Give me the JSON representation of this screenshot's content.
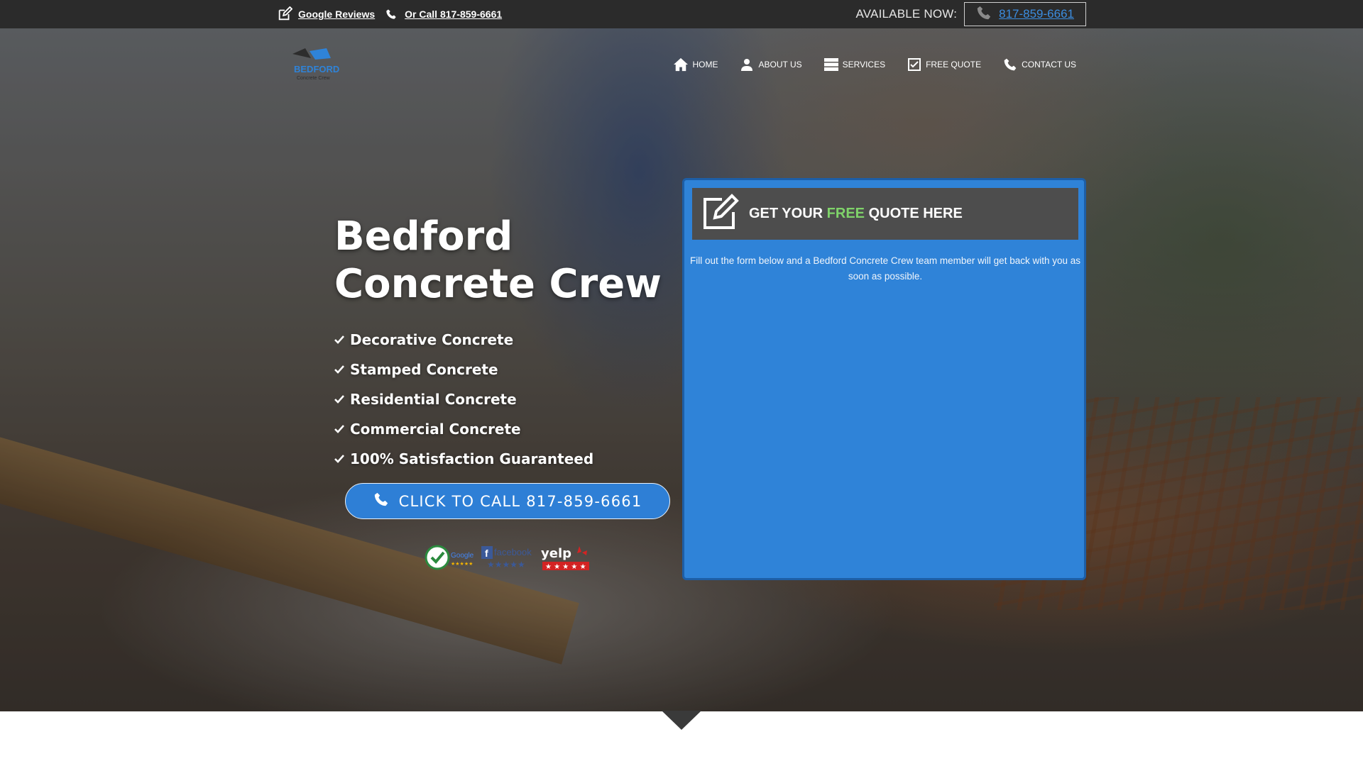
{
  "topbar": {
    "reviews_label": "Google Reviews",
    "call_label": "Or Call 817-859-6661",
    "available_label": "AVAILABLE NOW:",
    "phone_number": "817-859-6661"
  },
  "logo": {
    "text": "BEDFORD",
    "subtext": "Concrete Crew"
  },
  "nav": {
    "items": [
      {
        "label": "HOME",
        "icon": "home-icon"
      },
      {
        "label": "ABOUT US",
        "icon": "user-icon"
      },
      {
        "label": "SERVICES",
        "icon": "list-icon"
      },
      {
        "label": "FREE QUOTE",
        "icon": "checkbox-icon"
      },
      {
        "label": "CONTACT US",
        "icon": "phone-icon"
      }
    ]
  },
  "hero": {
    "title_line1": "Bedford",
    "title_line2": "Concrete Crew",
    "features": [
      "Decorative Concrete",
      "Stamped Concrete",
      "Residential Concrete",
      "Commercial Concrete",
      "100% Satisfaction Guaranteed"
    ],
    "cta_label": "CLICK TO CALL 817-859-6661"
  },
  "badges": {
    "google": "Google",
    "facebook": "facebook",
    "yelp": "yelp"
  },
  "quote": {
    "title_pre": "GET YOUR",
    "title_highlight": "FREE",
    "title_post": "QUOTE HERE",
    "description": "Fill out the form below and a Bedford Concrete Crew team member will get back with you as soon as possible."
  },
  "colors": {
    "accent_blue": "#2f83d8",
    "topbar_bg": "#2b2b2b",
    "free_green": "#7fd36a",
    "link_blue": "#3b8de0"
  }
}
